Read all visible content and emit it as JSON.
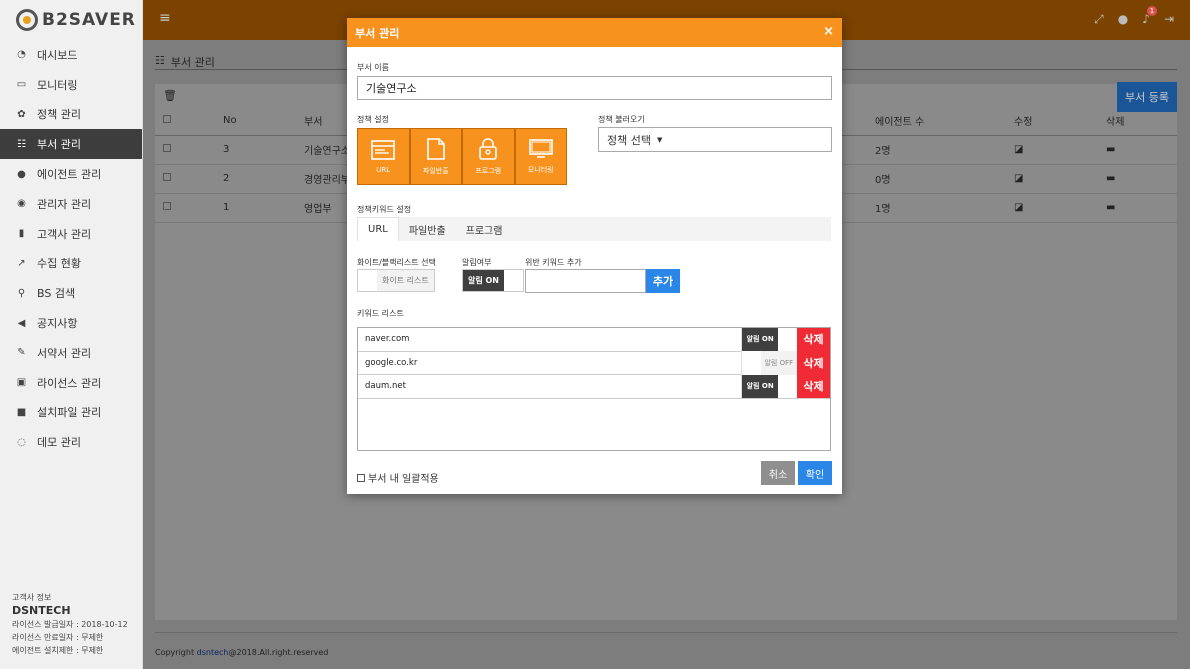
{
  "app": {
    "logo_text": "B2SAVER"
  },
  "sidebar": {
    "items": [
      {
        "label": "대시보드",
        "icon": "dashboard-icon"
      },
      {
        "label": "모니터링",
        "icon": "monitor-icon"
      },
      {
        "label": "정책 관리",
        "icon": "gear-icon"
      },
      {
        "label": "부서 관리",
        "icon": "sitemap-icon",
        "active": true
      },
      {
        "label": "에이전트 관리",
        "icon": "user-icon"
      },
      {
        "label": "관리자 관리",
        "icon": "user-circle-icon"
      },
      {
        "label": "고객사 관리",
        "icon": "building-icon"
      },
      {
        "label": "수집 현황",
        "icon": "line-chart-icon"
      },
      {
        "label": "BS 검색",
        "icon": "search-icon"
      },
      {
        "label": "공지사항",
        "icon": "bullhorn-icon"
      },
      {
        "label": "서약서 관리",
        "icon": "edit-icon"
      },
      {
        "label": "라이선스 관리",
        "icon": "license-icon"
      },
      {
        "label": "설치파일 관리",
        "icon": "folder-icon"
      },
      {
        "label": "데모 관리",
        "icon": "chat-icon"
      }
    ],
    "info": {
      "heading": "고객사 정보",
      "company": "DSNTECH",
      "issue_date": "라이선스 발급일자 : 2018-10-12",
      "expire_date": "라이선스 만료일자 : 무제한",
      "agent_limit": "에이전트 설치제한 : 무제한"
    }
  },
  "header": {
    "notification_count": "1"
  },
  "page": {
    "title": "부서 관리",
    "add_button": "부서 등록",
    "table": {
      "columns": [
        "No",
        "부서",
        "에이전트 수",
        "수정",
        "삭제"
      ],
      "rows": [
        {
          "no": "3",
          "dept": "기술연구소",
          "agents": "2명"
        },
        {
          "no": "2",
          "dept": "경영관리부",
          "agents": "0명"
        },
        {
          "no": "1",
          "dept": "영업부",
          "agents": "1명"
        }
      ]
    },
    "footer": {
      "prefix": "Copyright ",
      "link": "dsntech",
      "suffix": "@2018.All.right.reserved"
    }
  },
  "modal": {
    "title": "부서 관리",
    "dept_name_label": "부서 이름",
    "dept_name_value": "기술연구소",
    "policy_label": "정책 설정",
    "policy_buttons": [
      "URL",
      "파일반출",
      "프로그램",
      "모니터링"
    ],
    "policy_load_label": "정책 불러오기",
    "policy_select": "정책 선택",
    "keyword_section_label": "정책키워드 설정",
    "tabs": [
      "URL",
      "파일반출",
      "프로그램"
    ],
    "list_select_label": "화이트/블랙리스트 선택",
    "list_select_value": "화이트 리스트",
    "alert_label": "알림여부",
    "alert_value": "알림 ON",
    "add_keyword_label": "위반 키워드 추가",
    "add_keyword_placeholder": "",
    "add_button": "추가",
    "keyword_list_label": "키워드 리스트",
    "keywords": [
      {
        "text": "naver.com",
        "alert": "알림 ON",
        "on": true
      },
      {
        "text": "google.co.kr",
        "alert": "알림 OFF",
        "on": false
      },
      {
        "text": "daum.net",
        "alert": "알림 ON",
        "on": true
      }
    ],
    "delete_label": "삭제",
    "apply_all_label": "부서 내 일괄적용",
    "cancel_button": "취소",
    "ok_button": "확인"
  },
  "colors": {
    "accent": "#f7921e",
    "header_bg": "#7b4200",
    "primary_blue": "#2a87e8",
    "danger_red": "#f02b35"
  }
}
